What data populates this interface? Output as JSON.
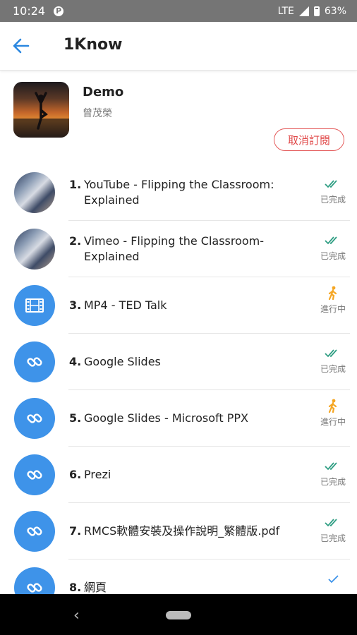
{
  "status_bar": {
    "time": "10:24",
    "network": "LTE",
    "battery": "63%"
  },
  "app_bar": {
    "title": "1Know"
  },
  "course": {
    "title": "Demo",
    "author": "曾茂榮",
    "unsubscribe_label": "取消訂閱"
  },
  "colors": {
    "accent": "#3e93e9",
    "done_check": "#2f9e83",
    "in_progress": "#f5a623",
    "unsubscribe": "#e04848"
  },
  "items": [
    {
      "num": "1.",
      "title": "YouTube - Flipping the Classroom: Explained",
      "status": "已完成",
      "icon": "video-thumbnail"
    },
    {
      "num": "2.",
      "title": "Vimeo - Flipping the Classroom-Explained",
      "status": "已完成",
      "icon": "video-thumbnail"
    },
    {
      "num": "3.",
      "title": "MP4 - TED Talk",
      "status": "進行中",
      "icon": "film-icon"
    },
    {
      "num": "4.",
      "title": "Google Slides",
      "status": "已完成",
      "icon": "link-icon"
    },
    {
      "num": "5.",
      "title": "Google Slides - Microsoft PPX",
      "status": "進行中",
      "icon": "link-icon"
    },
    {
      "num": "6.",
      "title": "Prezi",
      "status": "已完成",
      "icon": "link-icon"
    },
    {
      "num": "7.",
      "title": "RMCS軟體安裝及操作說明_繁體版.pdf",
      "status": "已完成",
      "icon": "link-icon"
    },
    {
      "num": "8.",
      "title": "網頁",
      "status": "",
      "icon": "link-icon"
    }
  ]
}
